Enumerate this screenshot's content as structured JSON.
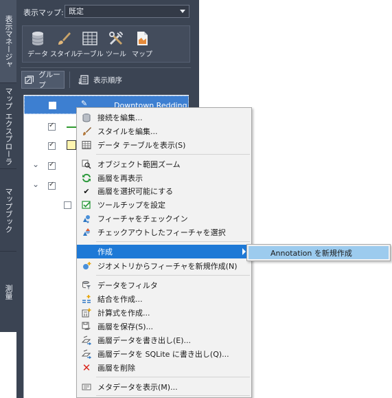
{
  "tabs": {
    "active": "表示マネージャ",
    "explorer": "マップ エクスプローラ",
    "mapbook": "マップブック",
    "survey": "測量"
  },
  "map_label": "表示マップ:",
  "map_select": "既定",
  "toolbar": {
    "data": "データ",
    "style": "スタイル",
    "table": "テーブル",
    "tools": "ツール",
    "map": "マップ"
  },
  "group_label": "グループ",
  "order_label": "表示順序",
  "layer_name": "Downtown Redding",
  "menu": {
    "edit_connection": "接続を編集...",
    "edit_style": "スタイルを編集...",
    "show_table": "データ テーブルを表示(S)",
    "zoom_extents": "オブジェクト範囲ズーム",
    "refresh_layer": "画層を再表示",
    "make_selectable": "画層を選択可能にする",
    "set_tooltip": "ツールチップを設定",
    "checkin": "フィーチャをチェックイン",
    "select_checkedout": "チェックアウトしたフィーチャを選択",
    "create": "作成",
    "new_from_geometry": "ジオメトリからフィーチャを新規作成(N)",
    "filter": "データをフィルタ",
    "create_join": "結合を作成...",
    "create_calc": "計算式を作成...",
    "save_layer": "画層を保存(S)...",
    "export_layer": "画層データを書き出し(E)...",
    "export_sqlite": "画層データを SQLite に書き出し(Q)...",
    "delete_layer": "画層を削除",
    "show_metadata": "メタデータを表示(M)..."
  },
  "submenu": {
    "new_annotation": "Annotation を新規作成"
  },
  "colors": {
    "panel": "#3b4453",
    "selection": "#3d7fd1",
    "menu_highlight": "#1e79d6",
    "submenu_highlight": "#9ccbee"
  }
}
